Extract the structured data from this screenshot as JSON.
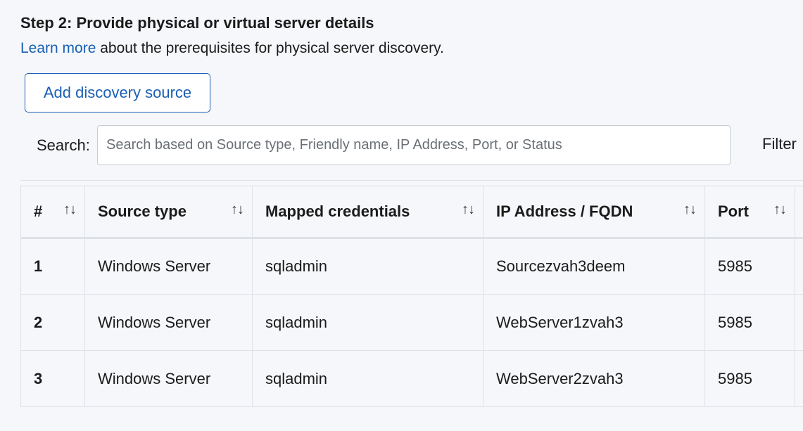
{
  "step": {
    "heading": "Step 2: Provide physical or virtual server details",
    "learn_more_link": "Learn more",
    "intro_rest": " about the prerequisites for physical server discovery."
  },
  "toolbar": {
    "add_label": "Add discovery source"
  },
  "search": {
    "label": "Search:",
    "placeholder": "Search based on Source type, Friendly name, IP Address, Port, or Status",
    "value": ""
  },
  "filter": {
    "label": "Filter"
  },
  "table": {
    "sort_glyph": "↑↓",
    "columns": [
      "#",
      "Source type",
      "Mapped credentials",
      "IP Address / FQDN",
      "Port"
    ],
    "rows": [
      [
        "1",
        "Windows Server",
        "sqladmin",
        "Sourcezvah3deem",
        "5985"
      ],
      [
        "2",
        "Windows Server",
        "sqladmin",
        "WebServer1zvah3",
        "5985"
      ],
      [
        "3",
        "Windows Server",
        "sqladmin",
        "WebServer2zvah3",
        "5985"
      ]
    ]
  }
}
